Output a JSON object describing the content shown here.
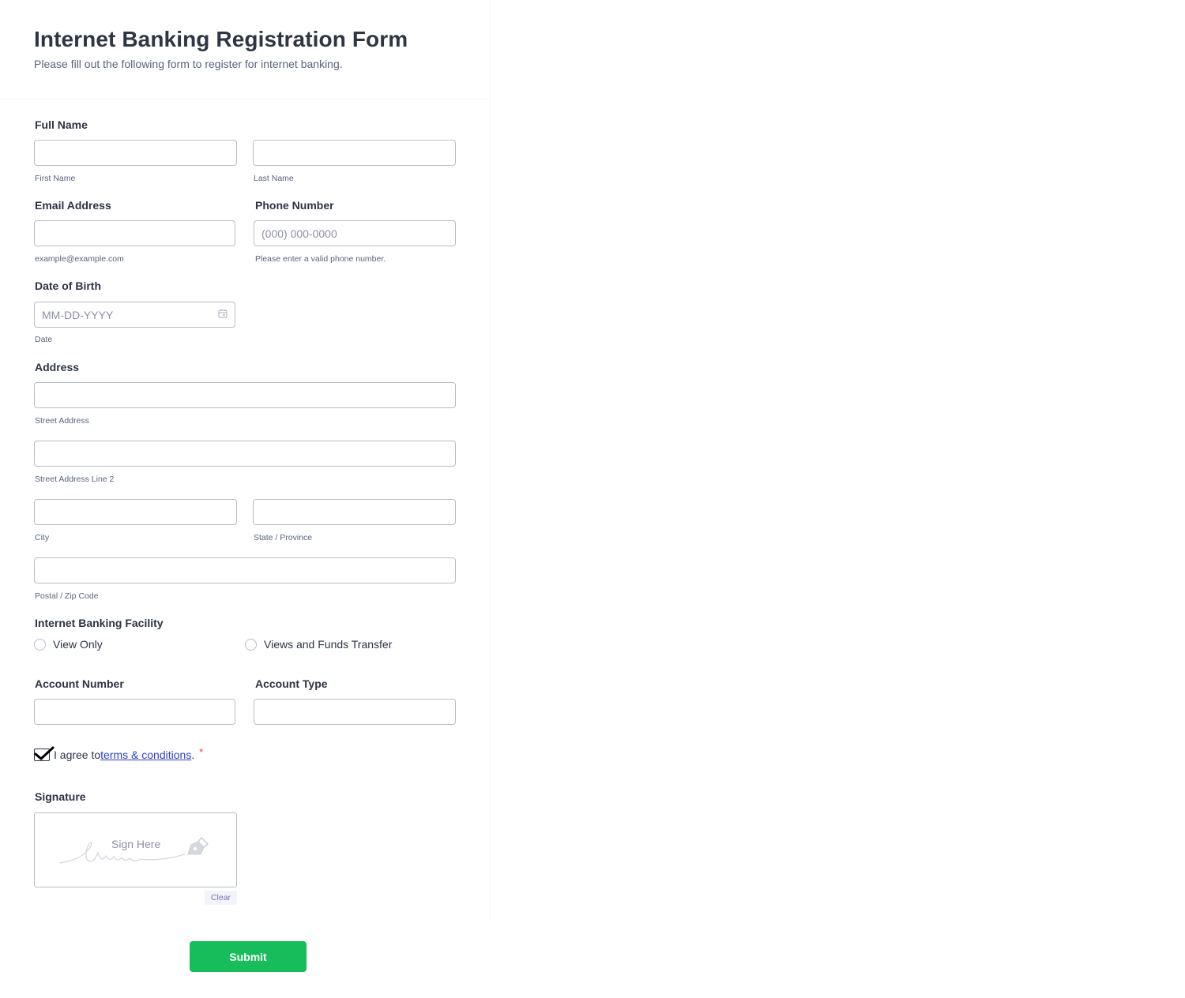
{
  "header": {
    "title": "Internet Banking Registration Form",
    "subtitle": "Please fill out the following form to register for internet banking."
  },
  "full_name": {
    "label": "Full Name",
    "first_sublabel": "First Name",
    "last_sublabel": "Last Name",
    "first_value": "",
    "last_value": ""
  },
  "email": {
    "label": "Email Address",
    "value": "",
    "sublabel": "example@example.com"
  },
  "phone": {
    "label": "Phone Number",
    "placeholder": "(000) 000-0000",
    "value": "",
    "sublabel": "Please enter a valid phone number."
  },
  "dob": {
    "label": "Date of Birth",
    "placeholder": "MM-DD-YYYY",
    "value": "",
    "sublabel": "Date",
    "icon": "calendar-icon"
  },
  "address": {
    "label": "Address",
    "street_sublabel": "Street Address",
    "street2_sublabel": "Street Address Line 2",
    "city_sublabel": "City",
    "state_sublabel": "State / Province",
    "zip_sublabel": "Postal / Zip Code"
  },
  "facility": {
    "label": "Internet Banking Facility",
    "options": [
      "View Only",
      "Views and Funds Transfer"
    ],
    "selected": ""
  },
  "account": {
    "number_label": "Account Number",
    "type_label": "Account Type",
    "number_value": "",
    "type_value": ""
  },
  "terms": {
    "prefix": "I agree to ",
    "link": "terms & conditions",
    "suffix": ".",
    "required": "*",
    "checked": true
  },
  "signature": {
    "label": "Signature",
    "placeholder": "Sign Here",
    "clear_label": "Clear",
    "icon": "pen-icon"
  },
  "submit_label": "Submit",
  "colors": {
    "submit": "#18bd5b",
    "link": "#2c40c9",
    "required": "#f23a3c",
    "border": "#b8bdc9",
    "text": "#2c3345"
  }
}
